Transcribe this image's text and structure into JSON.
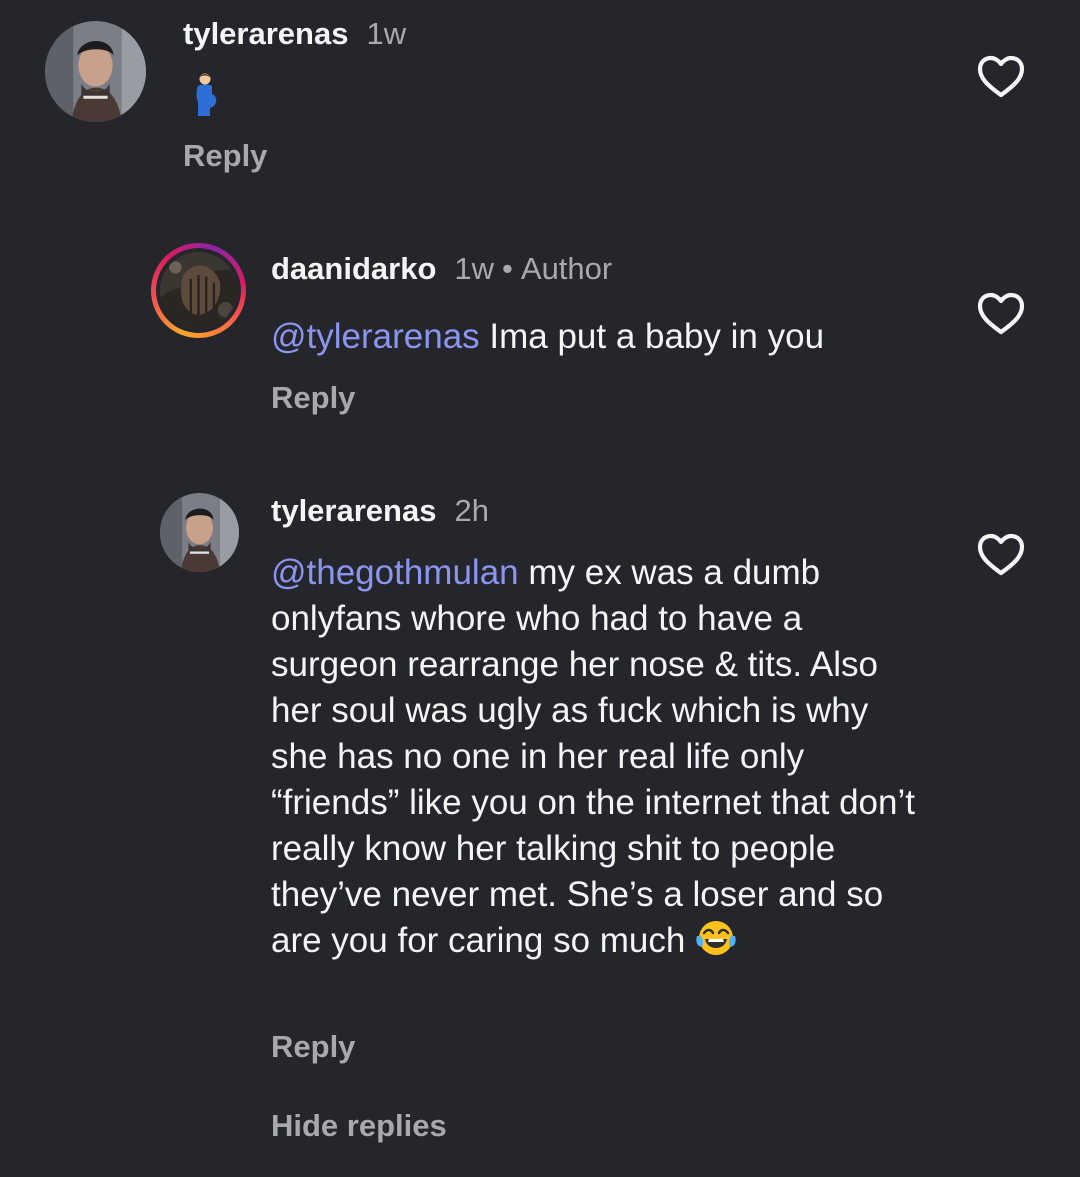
{
  "comments": [
    {
      "username": "tylerarenas",
      "time": "1w",
      "body_emoji": "pregnant-man-emoji",
      "reply_label": "Reply",
      "avatar": "tylerarenas-avatar"
    },
    {
      "username": "daanidarko",
      "time": "1w",
      "separator": "•",
      "author_label": "Author",
      "mention": "@tylerarenas",
      "text": " Ima put a baby in you",
      "reply_label": "Reply",
      "avatar": "daanidarko-avatar"
    },
    {
      "username": "tylerarenas",
      "time": "2h",
      "mention": "@thegothmulan",
      "text": " my ex was a dumb onlyfans whore who had to have a surgeon rearrange her nose & tits. Also her soul was ugly as fuck which is why she has no one in her real life only “friends” like you on the internet that don’t really know her talking shit to people they’ve never met. She’s a loser and so are you for caring so much ",
      "trailing_emoji": "face-with-tears-of-joy-emoji",
      "reply_label": "Reply",
      "avatar": "tylerarenas-avatar"
    }
  ],
  "hide_replies_label": "Hide replies",
  "colors": {
    "background": "#25262b",
    "text": "#f5f5f5",
    "muted": "#a8a8ad",
    "mention": "#8b95f0"
  },
  "icons": {
    "like": "heart-outline-icon"
  }
}
